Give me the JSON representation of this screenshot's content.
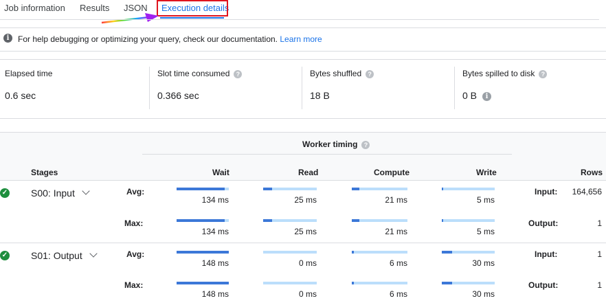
{
  "tabs": [
    {
      "label": "Job information",
      "active": false
    },
    {
      "label": "Results",
      "active": false
    },
    {
      "label": "JSON",
      "active": false
    },
    {
      "label": "Execution details",
      "active": true
    }
  ],
  "help": {
    "icon": "info-icon",
    "text": "For help debugging or optimizing your query, check our documentation.",
    "link": "Learn more"
  },
  "metrics": [
    {
      "label": "Elapsed time",
      "value": "0.6 sec",
      "help": false,
      "value_info": false
    },
    {
      "label": "Slot time consumed",
      "value": "0.366 sec",
      "help": true,
      "value_info": false
    },
    {
      "label": "Bytes shuffled",
      "value": "18 B",
      "help": true,
      "value_info": false
    },
    {
      "label": "Bytes spilled to disk",
      "value": "0 B",
      "help": true,
      "value_info": true
    }
  ],
  "worker_timing": {
    "title": "Worker timing"
  },
  "columns": {
    "stages": "Stages",
    "wait": "Wait",
    "read": "Read",
    "compute": "Compute",
    "write": "Write",
    "rows": "Rows"
  },
  "row_labels": {
    "avg": "Avg:",
    "max": "Max:",
    "input": "Input:",
    "output": "Output:"
  },
  "colors": {
    "bar_fill": "#3c78d8",
    "bar_track": "#bbdefb",
    "success": "#1e8e3e",
    "link": "#1a73e8",
    "highlight": "#e0141e"
  },
  "stages": [
    {
      "name": "S00: Input",
      "status": "success",
      "avg": {
        "wait": {
          "text": "134 ms",
          "fraction": 0.92
        },
        "read": {
          "text": "25 ms",
          "fraction": 0.17
        },
        "compute": {
          "text": "21 ms",
          "fraction": 0.14
        },
        "write": {
          "text": "5 ms",
          "fraction": 0.03
        }
      },
      "max": {
        "wait": {
          "text": "134 ms",
          "fraction": 0.92
        },
        "read": {
          "text": "25 ms",
          "fraction": 0.17
        },
        "compute": {
          "text": "21 ms",
          "fraction": 0.14
        },
        "write": {
          "text": "5 ms",
          "fraction": 0.03
        }
      },
      "input_rows": "164,656",
      "output_rows": "1"
    },
    {
      "name": "S01: Output",
      "status": "success",
      "avg": {
        "wait": {
          "text": "148 ms",
          "fraction": 1.0
        },
        "read": {
          "text": "0 ms",
          "fraction": 0.0
        },
        "compute": {
          "text": "6 ms",
          "fraction": 0.04
        },
        "write": {
          "text": "30 ms",
          "fraction": 0.2
        }
      },
      "max": {
        "wait": {
          "text": "148 ms",
          "fraction": 1.0
        },
        "read": {
          "text": "0 ms",
          "fraction": 0.0
        },
        "compute": {
          "text": "6 ms",
          "fraction": 0.04
        },
        "write": {
          "text": "30 ms",
          "fraction": 0.2
        }
      },
      "input_rows": "1",
      "output_rows": "1"
    }
  ]
}
